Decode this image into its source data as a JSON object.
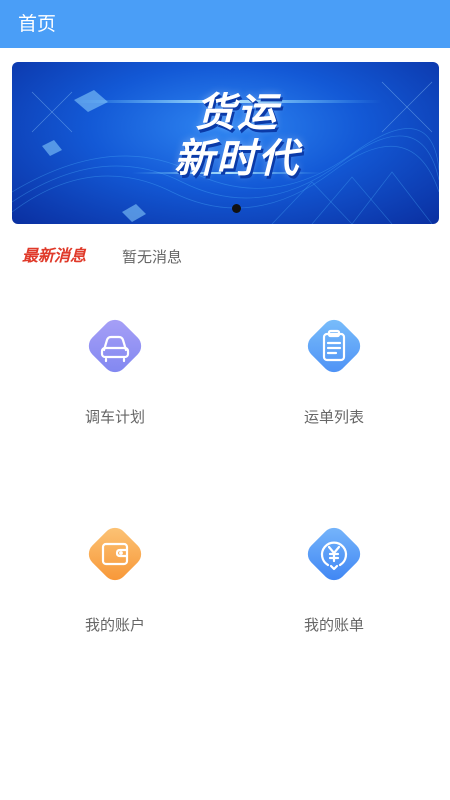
{
  "appbar": {
    "title": "首页"
  },
  "banner": {
    "headline_line1": "货运",
    "headline_line2": "新时代",
    "active_page": 1,
    "page_count": 1
  },
  "news": {
    "tag": "最新消息",
    "message": "暂无消息"
  },
  "menu": [
    {
      "label": "调车计划",
      "icon": "car-icon",
      "color": "#8f8ff2"
    },
    {
      "label": "运单列表",
      "icon": "clipboard-icon",
      "color": "#5a9df7"
    },
    {
      "label": "我的账户",
      "icon": "wallet-icon",
      "color": "#f7a24a"
    },
    {
      "label": "我的账单",
      "icon": "yen-bill-icon",
      "color": "#4a8ff7"
    }
  ]
}
